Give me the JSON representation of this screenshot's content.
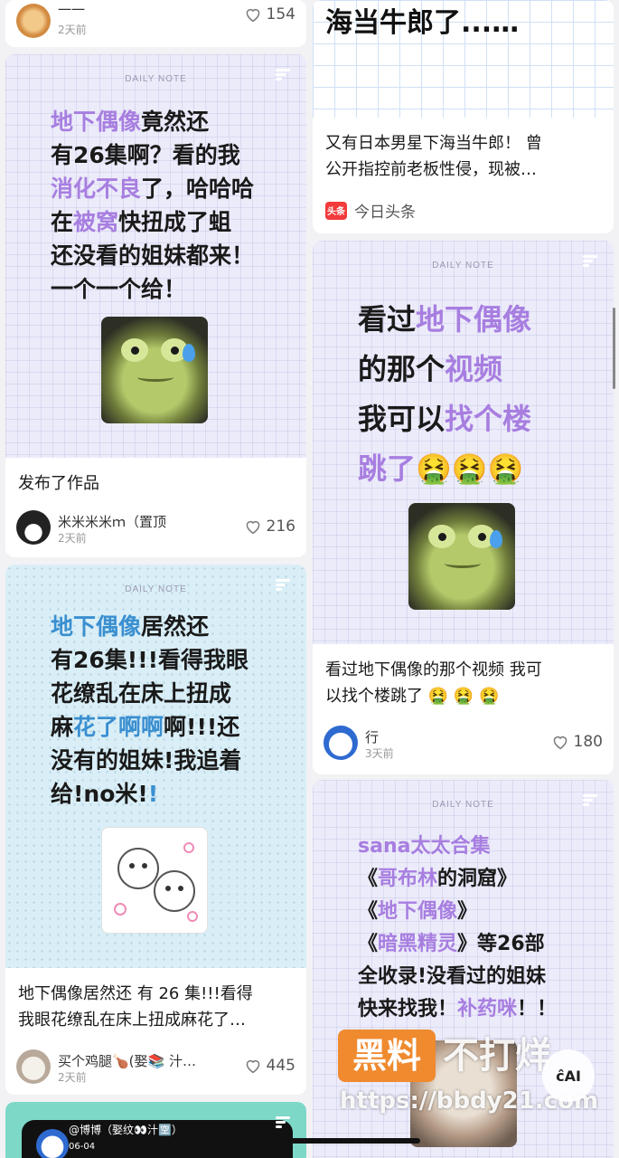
{
  "cards": {
    "top_left": {
      "author": "一一",
      "time": "2天前",
      "likes": "154"
    },
    "note1": {
      "tag": "DAILY NOTE",
      "lines": [
        {
          "parts": [
            {
              "t": "地下偶像",
              "c": "purple"
            },
            {
              "t": "竟然还",
              "c": ""
            }
          ]
        },
        {
          "parts": [
            {
              "t": "有26集啊？看的我",
              "c": ""
            }
          ]
        },
        {
          "parts": [
            {
              "t": "消化不良",
              "c": "purple"
            },
            {
              "t": "了，哈哈哈",
              "c": ""
            }
          ]
        },
        {
          "parts": [
            {
              "t": "在",
              "c": ""
            },
            {
              "t": "被窝",
              "c": "purple"
            },
            {
              "t": "快扭成了蛆",
              "c": ""
            }
          ]
        },
        {
          "parts": [
            {
              "t": "还没看的姐妹都来！",
              "c": ""
            }
          ]
        },
        {
          "parts": [
            {
              "t": "一个一个给！",
              "c": ""
            }
          ]
        }
      ],
      "caption": "发布了作品",
      "author": "米米米米ｍ（置顶",
      "time": "2天前",
      "likes": "216"
    },
    "note2": {
      "tag": "DAILY NOTE",
      "lines": [
        {
          "parts": [
            {
              "t": "地下偶像",
              "c": "blue"
            },
            {
              "t": "居然还",
              "c": ""
            }
          ]
        },
        {
          "parts": [
            {
              "t": "有26集!!!看得我眼",
              "c": ""
            }
          ]
        },
        {
          "parts": [
            {
              "t": "花缭乱在床上扭成",
              "c": ""
            }
          ]
        },
        {
          "parts": [
            {
              "t": "麻",
              "c": ""
            },
            {
              "t": "花了",
              "c": "blue"
            },
            {
              "t": "啊啊",
              "c": "blue"
            },
            {
              "t": "啊!!!还",
              "c": ""
            }
          ]
        },
        {
          "parts": [
            {
              "t": "没有的姐妹!我追着",
              "c": ""
            }
          ]
        },
        {
          "parts": [
            {
              "t": "给!no米!",
              "c": ""
            },
            {
              "t": "!",
              "c": "blue"
            }
          ]
        }
      ],
      "caption_l1": "地下偶像居然还 有 26 集!!!看得",
      "caption_l2": "我眼花缭乱在床上扭成麻花了…",
      "author": "买个鸡腿🍗(娶📚 汁…",
      "time": "2天前",
      "likes": "445"
    },
    "bottom_left": {
      "author": "@博博（娶纹👀汁🈳）",
      "date": "06-04"
    },
    "news": {
      "title": "海当牛郎了...…",
      "caption_l1": "又有日本男星下海当牛郎！ 曾",
      "caption_l2": "公开指控前老板性侵，现被…",
      "source_badge": "头条",
      "source": "今日头条"
    },
    "note3": {
      "tag": "DAILY NOTE",
      "lines": [
        {
          "parts": [
            {
              "t": "看过",
              "c": ""
            },
            {
              "t": "地下偶像",
              "c": "purple"
            }
          ]
        },
        {
          "parts": [
            {
              "t": "的那个",
              "c": ""
            },
            {
              "t": "视频",
              "c": "purple"
            }
          ]
        },
        {
          "parts": [
            {
              "t": "我可以",
              "c": ""
            },
            {
              "t": "找个楼",
              "c": "purple"
            }
          ]
        },
        {
          "parts": [
            {
              "t": "跳了",
              "c": "purple"
            },
            {
              "t": "🤮🤮🤮",
              "c": ""
            }
          ]
        }
      ],
      "caption_l1": "看过地下偶像的那个视频 我可",
      "caption_l2": "以找个楼跳了 🤮 🤮 🤮",
      "author": "行",
      "time": "3天前",
      "likes": "180"
    },
    "note4": {
      "tag": "DAILY NOTE",
      "lines": [
        {
          "parts": [
            {
              "t": "sana太太合集",
              "c": "purple"
            }
          ]
        },
        {
          "parts": [
            {
              "t": "《",
              "c": ""
            },
            {
              "t": "哥布林",
              "c": "purple"
            },
            {
              "t": "的洞窟》",
              "c": ""
            }
          ]
        },
        {
          "parts": [
            {
              "t": "《",
              "c": ""
            },
            {
              "t": "地下偶像",
              "c": "purple"
            },
            {
              "t": "》",
              "c": ""
            }
          ]
        },
        {
          "parts": [
            {
              "t": "《",
              "c": ""
            },
            {
              "t": "暗黑精灵",
              "c": "purple"
            },
            {
              "t": "》等26部",
              "c": ""
            }
          ]
        },
        {
          "parts": [
            {
              "t": "全收录!没看过的姐妹",
              "c": ""
            }
          ]
        },
        {
          "parts": [
            {
              "t": "快来找我！",
              "c": ""
            },
            {
              "t": "补药咪",
              "c": "purple"
            },
            {
              "t": "！！",
              "c": ""
            }
          ]
        }
      ]
    }
  },
  "watermark": {
    "box": "黑料",
    "text": "不打烊",
    "url": "https://bbdy21.com"
  },
  "ai_badge": "ĉAI"
}
